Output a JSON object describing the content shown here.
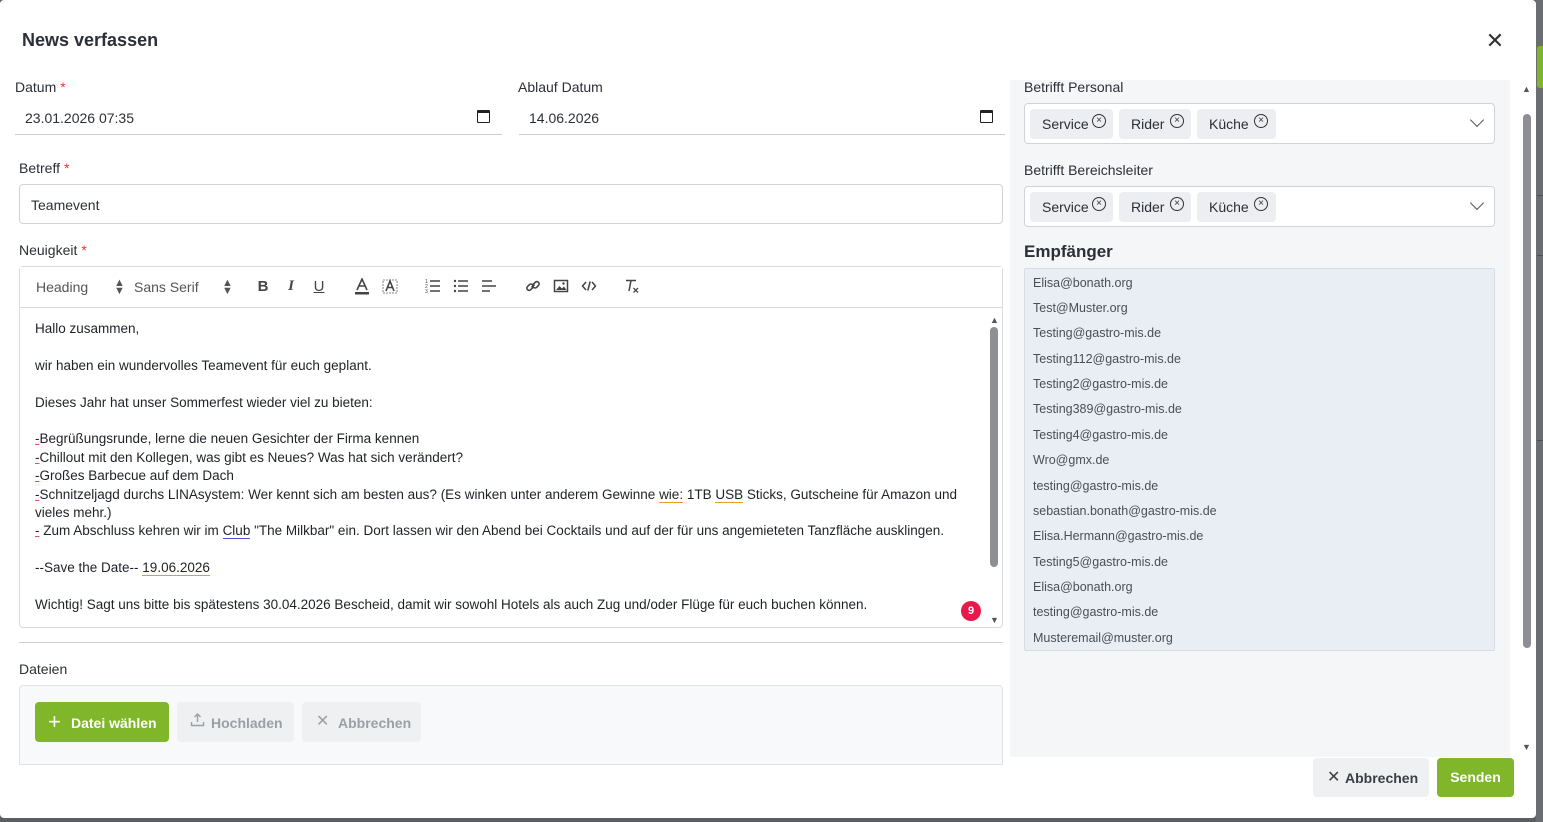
{
  "dialog": {
    "title": "News verfassen",
    "close_symbol": "✕"
  },
  "form": {
    "datum": {
      "label": "Datum",
      "required_mark": "*",
      "value": "23.01.2026 07:35"
    },
    "ablauf": {
      "label": "Ablauf Datum",
      "value": "14.06.2026"
    },
    "betreff": {
      "label": "Betreff",
      "required_mark": "*",
      "value": "Teamevent"
    },
    "neuigkeit": {
      "label": "Neuigkeit",
      "required_mark": "*"
    }
  },
  "toolbar": {
    "heading_select": "Heading",
    "font_select": "Sans Serif",
    "bold": "B",
    "italic": "I",
    "underline": "U"
  },
  "editor": {
    "greeting": "Hallo zusammen,",
    "line1": "wir haben ein wundervolles Teamevent für euch geplant.",
    "line2": "Dieses Jahr hat unser Sommerfest wieder viel zu bieten:",
    "b1": "Begrüßungsrunde, lerne die neuen Gesichter der Firma kennen",
    "b2": "Chillout mit den Kollegen, was gibt es Neues? Was hat sich verändert?",
    "b3": "Großes Barbecue auf dem Dach",
    "b4_a": "Schnitzeljagd durchs LINAsystem: Wer kennt sich am besten aus? (Es winken unter anderem Gewinne ",
    "b4_wie": "wie:",
    "b4_b": " 1TB ",
    "b4_usb": "USB",
    "b4_c": " Sticks, Gutscheine für Amazon und vieles mehr.)",
    "b5_a": " Zum Abschluss kehren wir im ",
    "b5_club": "Club",
    "b5_b": " \"The Milkbar\" ein. Dort lassen wir den Abend bei Cocktails und auf der für uns angemieteten Tanzfläche ausklingen.",
    "save_prefix": "--Save the Date-- ",
    "save_date": "19.06.2026",
    "closing": "Wichtig! Sagt uns bitte bis spätestens 30.04.2026 Bescheid, damit wir sowohl Hotels als auch Zug und/oder Flüge für euch buchen können.",
    "dash": "-",
    "badge_count": "9"
  },
  "files": {
    "label": "Dateien",
    "choose": "Datei wählen",
    "upload": "Hochladen",
    "cancel": "Abbrechen"
  },
  "personal": {
    "label": "Betrifft Personal",
    "chips": [
      "Service",
      "Rider",
      "Küche"
    ]
  },
  "bereichsleiter": {
    "label": "Betrifft Bereichsleiter",
    "chips": [
      "Service",
      "Rider",
      "Küche"
    ]
  },
  "empfaenger": {
    "title": "Empfänger",
    "items": [
      "Elisa@bonath.org",
      "Test@Muster.org",
      "Testing@gastro-mis.de",
      "Testing112@gastro-mis.de",
      "Testing2@gastro-mis.de",
      "Testing389@gastro-mis.de",
      "Testing4@gastro-mis.de",
      "Wro@gmx.de",
      "testing@gastro-mis.de",
      "sebastian.bonath@gastro-mis.de",
      "Elisa.Hermann@gastro-mis.de",
      "Testing5@gastro-mis.de",
      "Elisa@bonath.org",
      "testing@gastro-mis.de",
      "Musteremail@muster.org"
    ]
  },
  "footer": {
    "cancel": "Abbrechen",
    "send": "Senden"
  },
  "colors": {
    "accent": "#7fb62a",
    "required": "#ee3333",
    "badge": "#e8194a"
  }
}
